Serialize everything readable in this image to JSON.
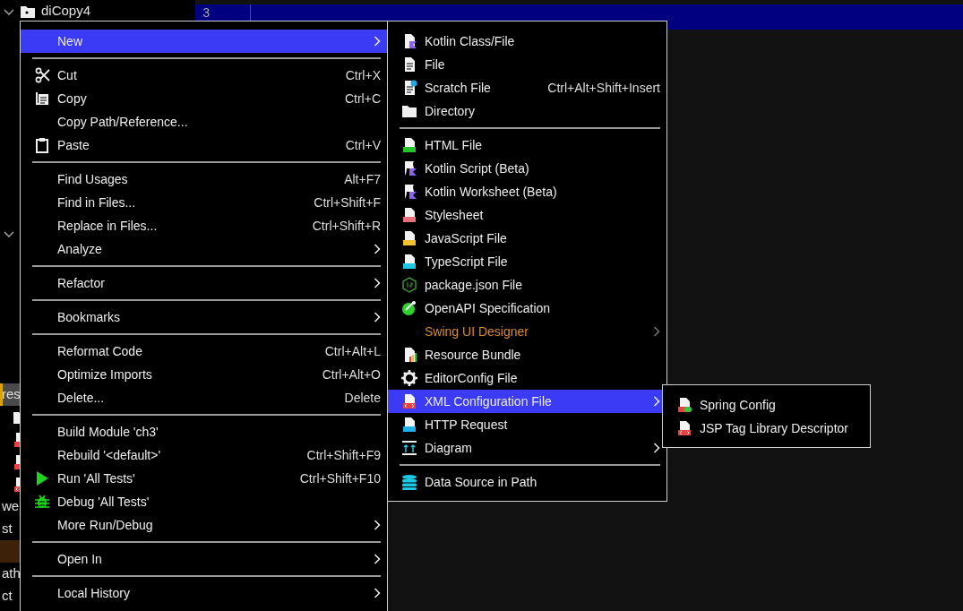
{
  "project_tree": [
    {
      "kind": "module-folder",
      "expanded": true,
      "label": "diCopy4",
      "selected": false
    },
    {
      "kind": "node",
      "expanded": true,
      "selected": false
    },
    {
      "kind": "text",
      "label": "res",
      "selected": true
    },
    {
      "kind": "folder",
      "selected": false
    },
    {
      "kind": "spring-xml",
      "selected": false
    },
    {
      "kind": "spring-xml",
      "selected": false
    },
    {
      "kind": "xml",
      "selected": false
    },
    {
      "kind": "text",
      "label": "we",
      "selected": false
    },
    {
      "kind": "text",
      "label": "st",
      "selected": false
    },
    {
      "kind": "blank",
      "color": "#3d2108",
      "selected": false
    },
    {
      "kind": "text",
      "label": "ath",
      "selected": false
    },
    {
      "kind": "text",
      "label": "ct",
      "selected": false
    }
  ],
  "editor": {
    "lines": [
      {
        "number": "3",
        "current": true
      }
    ]
  },
  "context_menu": {
    "items": [
      {
        "kind": "plain",
        "label": "New",
        "submenu": true,
        "selected": true
      },
      {
        "kind": "separator"
      },
      {
        "kind": "scissors",
        "label": "Cut",
        "shortcut": "Ctrl+X",
        "submenu": false,
        "selected": false
      },
      {
        "kind": "copy",
        "label": "Copy",
        "shortcut": "Ctrl+C",
        "submenu": false,
        "selected": false
      },
      {
        "kind": "plain",
        "label": "Copy Path/Reference...",
        "submenu": false,
        "selected": false
      },
      {
        "kind": "clipboard",
        "label": "Paste",
        "shortcut": "Ctrl+V",
        "submenu": false,
        "selected": false
      },
      {
        "kind": "separator"
      },
      {
        "kind": "plain",
        "label": "Find Usages",
        "shortcut": "Alt+F7",
        "submenu": false,
        "selected": false
      },
      {
        "kind": "plain",
        "label": "Find in Files...",
        "shortcut": "Ctrl+Shift+F",
        "submenu": false,
        "selected": false
      },
      {
        "kind": "plain",
        "label": "Replace in Files...",
        "shortcut": "Ctrl+Shift+R",
        "submenu": false,
        "selected": false
      },
      {
        "kind": "plain",
        "label": "Analyze",
        "submenu": true,
        "selected": false
      },
      {
        "kind": "separator"
      },
      {
        "kind": "plain",
        "label": "Refactor",
        "submenu": true,
        "selected": false
      },
      {
        "kind": "separator"
      },
      {
        "kind": "plain",
        "label": "Bookmarks",
        "submenu": true,
        "selected": false
      },
      {
        "kind": "separator"
      },
      {
        "kind": "plain",
        "label": "Reformat Code",
        "shortcut": "Ctrl+Alt+L",
        "submenu": false,
        "selected": false
      },
      {
        "kind": "plain",
        "label": "Optimize Imports",
        "shortcut": "Ctrl+Alt+O",
        "submenu": false,
        "selected": false
      },
      {
        "kind": "plain",
        "label": "Delete...",
        "shortcut": "Delete",
        "submenu": false,
        "selected": false
      },
      {
        "kind": "separator"
      },
      {
        "kind": "plain",
        "label": "Build Module 'ch3'",
        "submenu": false,
        "selected": false
      },
      {
        "kind": "plain",
        "label": "Rebuild '<default>'",
        "shortcut": "Ctrl+Shift+F9",
        "submenu": false,
        "selected": false
      },
      {
        "kind": "run",
        "label": "Run 'All Tests'",
        "shortcut": "Ctrl+Shift+F10",
        "submenu": false,
        "selected": false
      },
      {
        "kind": "bug",
        "label": "Debug 'All Tests'",
        "submenu": false,
        "selected": false
      },
      {
        "kind": "plain",
        "label": "More Run/Debug",
        "submenu": true,
        "selected": false
      },
      {
        "kind": "separator"
      },
      {
        "kind": "plain",
        "label": "Open In",
        "submenu": true,
        "selected": false
      },
      {
        "kind": "separator"
      },
      {
        "kind": "plain",
        "label": "Local History",
        "submenu": true,
        "selected": false
      }
    ]
  },
  "new_submenu": {
    "items": [
      {
        "kind": "kotlin-file",
        "label": "Kotlin Class/File",
        "submenu": false,
        "selected": false
      },
      {
        "kind": "file",
        "label": "File",
        "submenu": false,
        "selected": false
      },
      {
        "kind": "scratch",
        "label": "Scratch File",
        "shortcut": "Ctrl+Alt+Shift+Insert",
        "submenu": false,
        "selected": false
      },
      {
        "kind": "folder",
        "label": "Directory",
        "submenu": false,
        "selected": false
      },
      {
        "kind": "separator"
      },
      {
        "kind": "html",
        "label": "HTML File",
        "submenu": false,
        "selected": false
      },
      {
        "kind": "kotlin-script",
        "label": "Kotlin Script (Beta)",
        "submenu": false,
        "selected": false
      },
      {
        "kind": "kotlin-script",
        "label": "Kotlin Worksheet (Beta)",
        "submenu": false,
        "selected": false
      },
      {
        "kind": "css",
        "label": "Stylesheet",
        "submenu": false,
        "selected": false
      },
      {
        "kind": "js",
        "label": "JavaScript File",
        "submenu": false,
        "selected": false
      },
      {
        "kind": "ts",
        "label": "TypeScript File",
        "submenu": false,
        "selected": false
      },
      {
        "kind": "nodejs",
        "label": "package.json File",
        "submenu": false,
        "selected": false
      },
      {
        "kind": "openapi",
        "label": "OpenAPI Specification",
        "submenu": false,
        "selected": false
      },
      {
        "kind": "inactive",
        "label": "Swing UI Designer",
        "submenu": true,
        "selected": false
      },
      {
        "kind": "resource-bundle",
        "label": "Resource Bundle",
        "submenu": false,
        "selected": false
      },
      {
        "kind": "gear",
        "label": "EditorConfig File",
        "submenu": false,
        "selected": false
      },
      {
        "kind": "xml",
        "label": "XML Configuration File",
        "submenu": true,
        "selected": true
      },
      {
        "kind": "api",
        "label": "HTTP Request",
        "submenu": false,
        "selected": false
      },
      {
        "kind": "diagram",
        "label": "Diagram",
        "submenu": true,
        "selected": false
      },
      {
        "kind": "separator"
      },
      {
        "kind": "database",
        "label": "Data Source in Path",
        "submenu": false,
        "selected": false
      }
    ]
  },
  "xml_submenu": {
    "items": [
      {
        "kind": "spring-xml",
        "label": "Spring Config",
        "submenu": false,
        "selected": false
      },
      {
        "kind": "xml",
        "label": "JSP Tag Library Descriptor",
        "submenu": false,
        "selected": false
      }
    ]
  }
}
